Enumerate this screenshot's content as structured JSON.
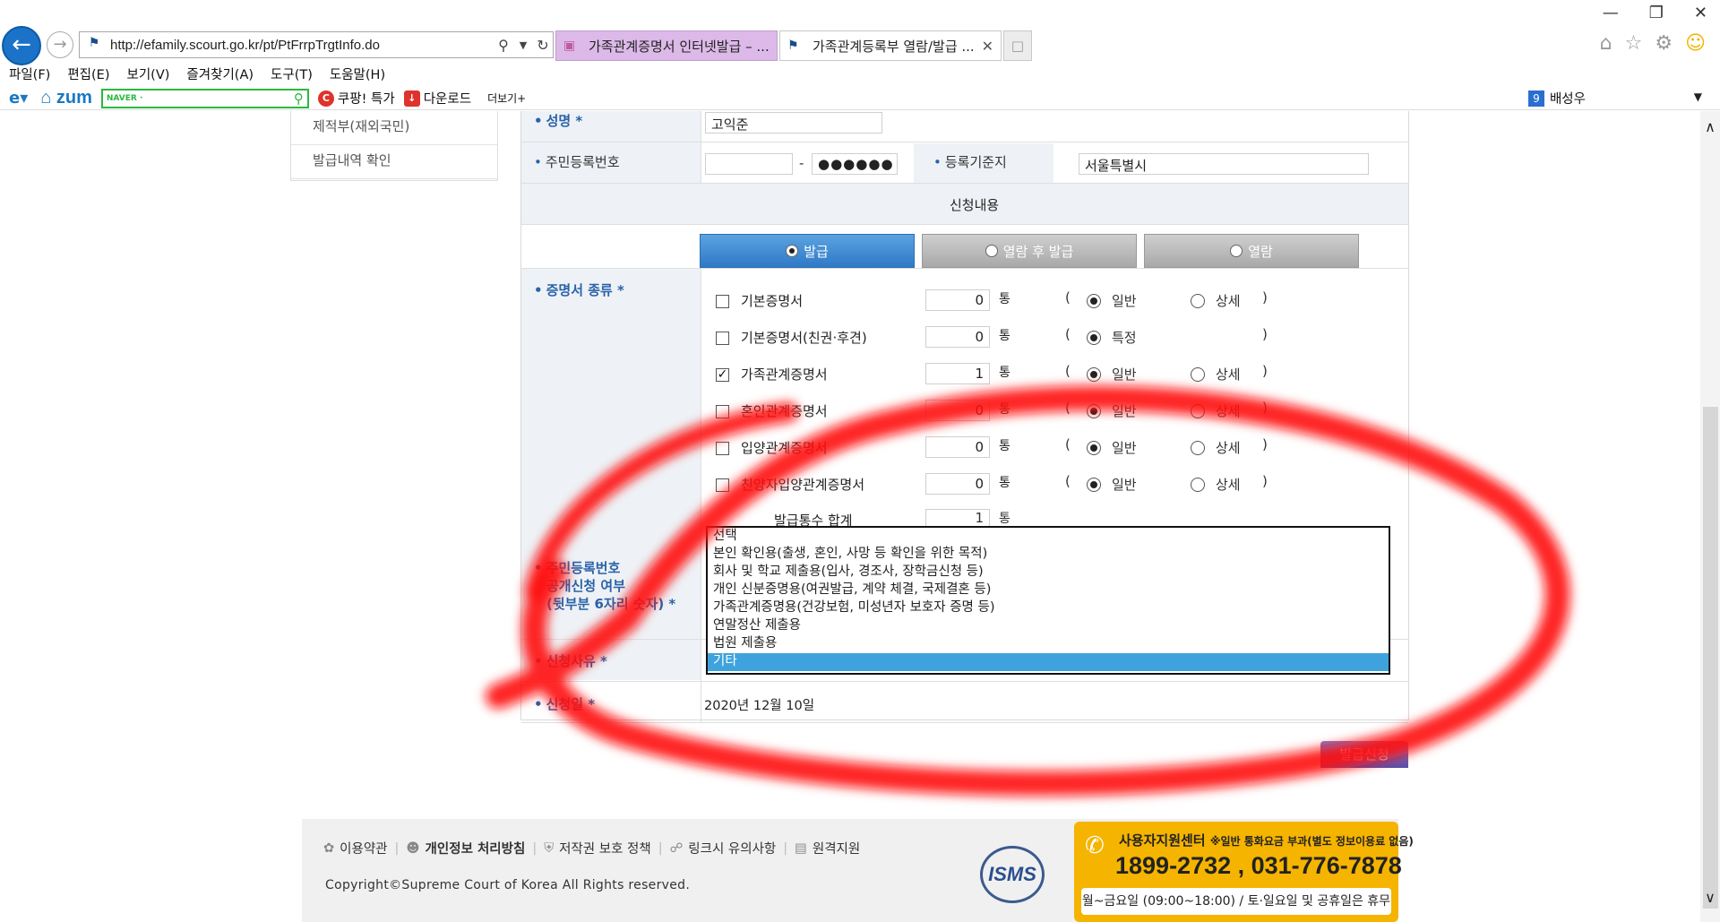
{
  "browser": {
    "url": "http://efamily.scourt.go.kr/pt/PtFrrpTrgtInfo.do",
    "tabs": [
      {
        "label": "가족관계증명서 인터넷발급 – ..."
      },
      {
        "label": "가족관계등록부 열람/발급 ..."
      }
    ],
    "menu": [
      "파일(F)",
      "편집(E)",
      "보기(V)",
      "즐겨찾기(A)",
      "도구(T)",
      "도움말(H)"
    ],
    "favorites": {
      "zum": "zum",
      "naver_label": "NAVER ·",
      "coupang": "쿠팡! 특가",
      "download": "다운로드",
      "more": "더보기+",
      "user_badge": "9",
      "user": "배성우"
    }
  },
  "subnav": {
    "items": [
      "제적부(재외국민)",
      "발급내역 확인"
    ]
  },
  "form": {
    "name_label": "성명 *",
    "name_value": "고익준",
    "rrn_label": "주민등록번호",
    "rrn_front": "",
    "rrn_dash": "-",
    "rrn_back": "●●●●●●",
    "base_label": "등록기준지",
    "base_value": "서울특별시",
    "section_title": "신청내용",
    "modes": [
      "발급",
      "열람 후 발급",
      "열람"
    ],
    "cert_label": "증명서 종류 *",
    "unit": "통",
    "lparen": "(",
    "rparen": ")",
    "certs": [
      {
        "name": "기본증명서",
        "checked": false,
        "qty": "0",
        "opt1": "일반",
        "opt2": "상세"
      },
      {
        "name": "기본증명서(친권·후견)",
        "checked": false,
        "qty": "0",
        "opt1": "특정",
        "opt2": ""
      },
      {
        "name": "가족관계증명서",
        "checked": true,
        "qty": "1",
        "opt1": "일반",
        "opt2": "상세"
      },
      {
        "name": "혼인관계증명서",
        "checked": false,
        "qty": "0",
        "opt1": "일반",
        "opt2": "상세"
      },
      {
        "name": "입양관계증명서",
        "checked": false,
        "qty": "0",
        "opt1": "일반",
        "opt2": "상세"
      },
      {
        "name": "친양자입양관계증명서",
        "checked": false,
        "qty": "0",
        "opt1": "일반",
        "opt2": "상세"
      }
    ],
    "total_label": "발급통수 합계",
    "total_qty": "1",
    "rrn_disclose_label": [
      "주민등록번호",
      "공개신청 여부",
      "(뒷부분 6자리 숫자) *"
    ],
    "reason_label": "신청사유 *",
    "reason_options": [
      "선택",
      "본인 확인용(출생, 혼인, 사망 등 확인을 위한 목적)",
      "회사 및 학교 제출용(입사, 경조사, 장학금신청 등)",
      "개인 신분증명용(여권발급, 계약 체결, 국제결혼 등)",
      "가족관계증명용(건강보험, 미성년자 보호자 증명 등)",
      "연말정산 제출용",
      "법원 제출용",
      "기타"
    ],
    "reason_selected": "기타",
    "date_label": "신청일 *",
    "date_value": "2020년 12월 10일",
    "submit": "발급신청"
  },
  "footer": {
    "links": [
      "이용약관",
      "개인정보 처리방침",
      "저작권 보호 정책",
      "링크시 유의사항",
      "원격지원"
    ],
    "copyright": "Copyright©Supreme Court of Korea All Rights reserved.",
    "isms": "ISMS",
    "support_title": "사용자지원센터",
    "support_note": "※일반 통화요금 부과(별도 정보이용료 없음)",
    "phones": "1899-2732 , 031-776-7878",
    "hours": "월~금요일 (09:00~18:00) / 토·일요일 및 공휴일은 휴무"
  }
}
